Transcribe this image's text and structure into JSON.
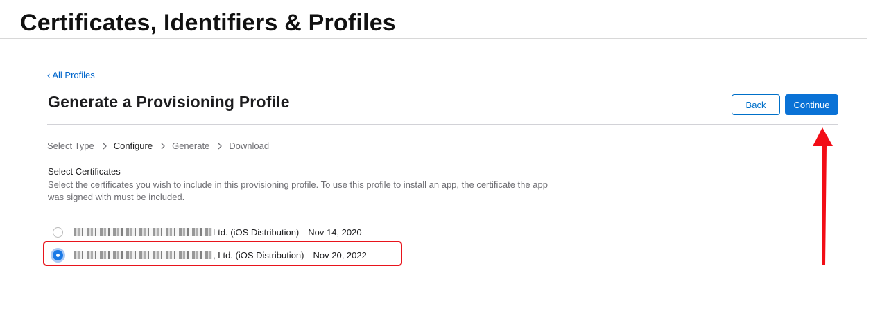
{
  "header": {
    "title": "Certificates, Identifiers & Profiles"
  },
  "nav": {
    "back_link_label": "All Profiles"
  },
  "section": {
    "title": "Generate a Provisioning Profile"
  },
  "actions": {
    "back_label": "Back",
    "continue_label": "Continue"
  },
  "steps": [
    {
      "label": "Select Type",
      "active": false
    },
    {
      "label": "Configure",
      "active": true
    },
    {
      "label": "Generate",
      "active": false
    },
    {
      "label": "Download",
      "active": false
    }
  ],
  "certificates": {
    "heading": "Select Certificates",
    "description": "Select the certificates you wish to include in this provisioning profile. To use this profile to install an app, the certificate the app was signed with must be included.",
    "items": [
      {
        "visible_name_suffix": "Ltd. (iOS Distribution)",
        "date": "Nov 14, 2020",
        "selected": false
      },
      {
        "visible_name_suffix": ", Ltd. (iOS Distribution)",
        "date": "Nov 20, 2022",
        "selected": true
      }
    ]
  },
  "annotation": {
    "highlight_color": "#e8141c",
    "arrow_color": "#f20d16"
  },
  "colors": {
    "link": "#0066cc",
    "primary_button": "#0a72d6",
    "radio_selected": "#1b7ae6"
  }
}
